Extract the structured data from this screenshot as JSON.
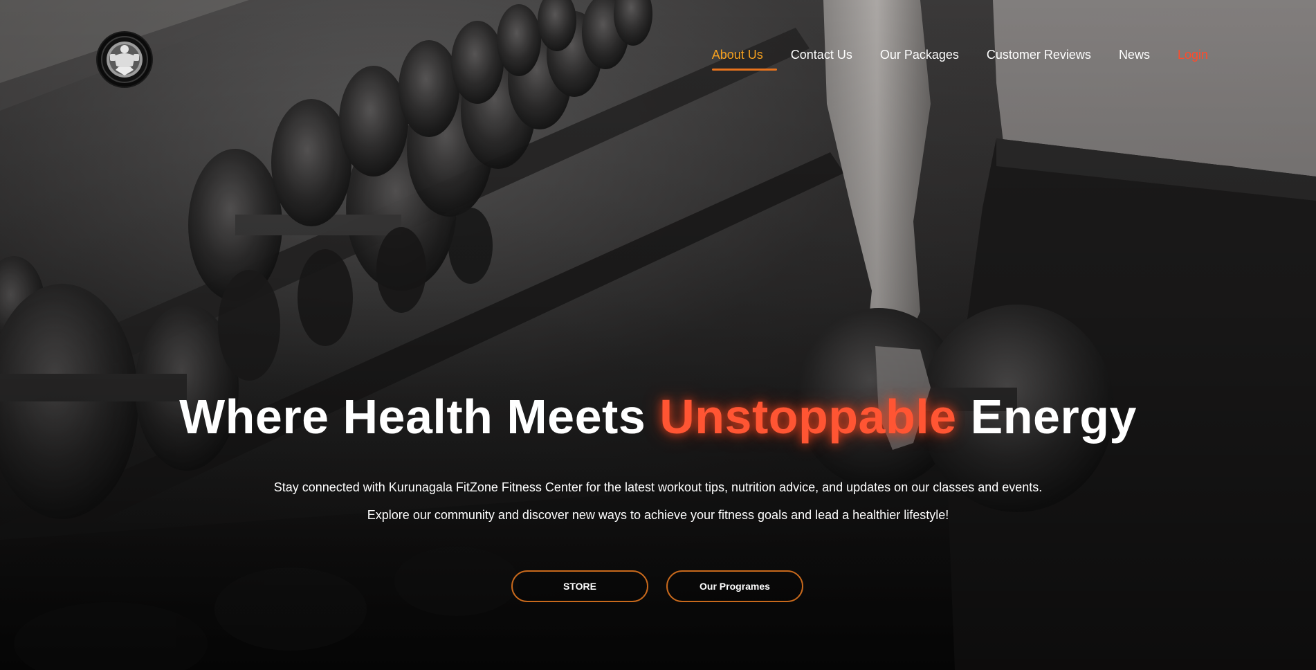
{
  "logo": {
    "icon": "bodybuilder-logo-icon"
  },
  "nav": {
    "items": [
      {
        "label": "About Us",
        "state": "active"
      },
      {
        "label": "Contact Us",
        "state": "default"
      },
      {
        "label": "Our Packages",
        "state": "default"
      },
      {
        "label": "Customer Reviews",
        "state": "default"
      },
      {
        "label": "News",
        "state": "default"
      },
      {
        "label": "Login",
        "state": "highlight"
      }
    ]
  },
  "hero": {
    "headline_part1": "Where Health Meets",
    "headline_accent": "Unstoppable",
    "headline_part2": "Energy",
    "subtitle_line1": "Stay connected with Kurunagala FitZone Fitness Center for the latest workout tips, nutrition advice, and updates on our classes and events.",
    "subtitle_line2": "Explore our community and discover new ways to achieve your fitness goals and lead a healthier lifestyle!",
    "buttons": {
      "store": "STORE",
      "programs": "Our Programes"
    }
  },
  "colors": {
    "nav_active": "#f6a11f",
    "nav_underline": "#e8731d",
    "login": "#ff4b2b",
    "accent_text": "#ff5533",
    "button_border": "#c8691c"
  }
}
